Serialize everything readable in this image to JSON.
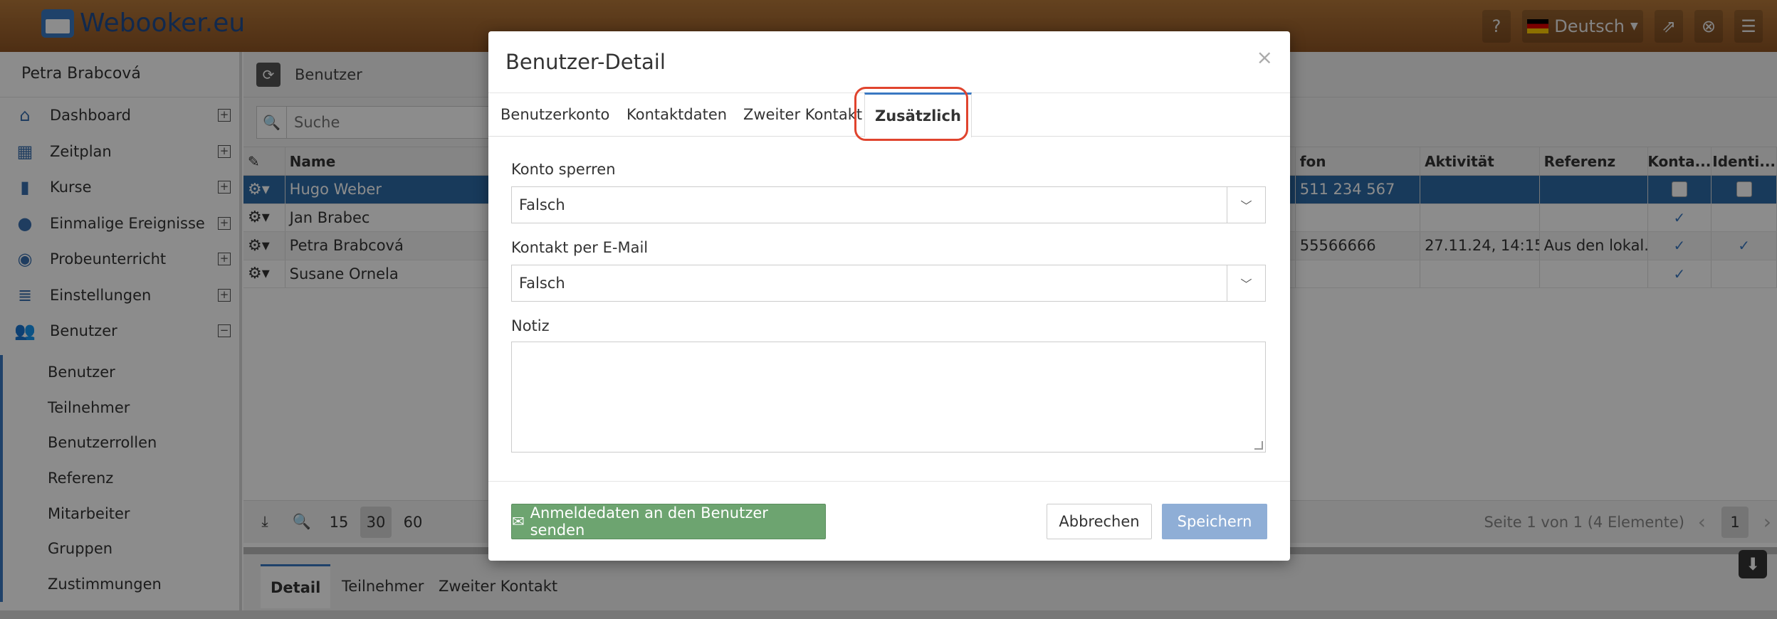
{
  "app": {
    "name": "Webooker.eu"
  },
  "topbar": {
    "language": "Deutsch"
  },
  "sidebar": {
    "user_name": "Petra Brabcová",
    "items": [
      {
        "label": "Dashboard",
        "icon": "home-icon"
      },
      {
        "label": "Zeitplan",
        "icon": "calendar-icon"
      },
      {
        "label": "Kurse",
        "icon": "book-icon"
      },
      {
        "label": "Einmalige Ereignisse",
        "icon": "ball-icon"
      },
      {
        "label": "Probeunterricht",
        "icon": "eye-icon"
      },
      {
        "label": "Einstellungen",
        "icon": "settings-icon"
      },
      {
        "label": "Benutzer",
        "icon": "users-icon"
      }
    ],
    "sub_items": [
      "Benutzer",
      "Teilnehmer",
      "Benutzerrollen",
      "Referenz",
      "Mitarbeiter",
      "Gruppen",
      "Zustimmungen"
    ]
  },
  "main": {
    "breadcrumb": "Benutzer",
    "search_placeholder": "Suche",
    "columns": {
      "name": "Name",
      "phone": "fon",
      "activity": "Aktivität",
      "reference": "Referenz",
      "contact": "Konta...",
      "identity": "Identi..."
    },
    "rows": [
      {
        "name": "Hugo Weber",
        "phone": "511 234 567",
        "activity": "",
        "reference": "",
        "contact": "box",
        "identity": "box"
      },
      {
        "name": "Jan Brabec",
        "phone": "",
        "activity": "",
        "reference": "",
        "contact": "check",
        "identity": ""
      },
      {
        "name": "Petra Brabcová",
        "phone": "55566666",
        "activity": "27.11.24, 14:15",
        "reference": "Aus den lokal...",
        "contact": "check",
        "identity": "check"
      },
      {
        "name": "Susane Ornela",
        "phone": "",
        "activity": "",
        "reference": "",
        "contact": "check",
        "identity": ""
      }
    ],
    "page_sizes": [
      "15",
      "30",
      "60"
    ],
    "pager_info": "Seite 1 von 1 (4 Elemente)",
    "current_page": "1",
    "detail_tabs": [
      "Detail",
      "Teilnehmer",
      "Zweiter Kontakt"
    ]
  },
  "modal": {
    "title": "Benutzer-Detail",
    "close": "×",
    "tabs": [
      "Benutzerkonto",
      "Kontaktdaten",
      "Zweiter Kontakt",
      "Zusätzlich"
    ],
    "fields": {
      "lock_label": "Konto sperren",
      "lock_value": "Falsch",
      "email_label": "Kontakt per E-Mail",
      "email_value": "Falsch",
      "note_label": "Notiz"
    },
    "buttons": {
      "send": "Anmeldedaten an den Benutzer senden",
      "cancel": "Abbrechen",
      "save": "Speichern"
    }
  }
}
